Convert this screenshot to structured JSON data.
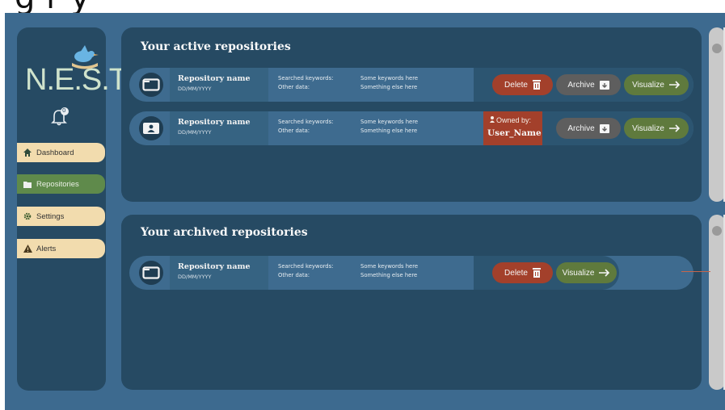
{
  "header": {
    "cut_heading": "g                    r                              y"
  },
  "sidebar": {
    "logo_text": "N.E.S.T.",
    "notification_count": "0",
    "items": [
      {
        "label": "Dashboard",
        "icon": "home-icon",
        "active": false
      },
      {
        "label": "Repositories",
        "icon": "folder-icon",
        "active": true
      },
      {
        "label": "Settings",
        "icon": "gear-icon",
        "active": false
      },
      {
        "label": "Alerts",
        "icon": "warning-icon",
        "active": false
      }
    ]
  },
  "active_panel": {
    "title": "Your active repositories",
    "rows": [
      {
        "name": "Repository name",
        "date": "DD/MM/YYYY",
        "meta_label_1": "Searched keywords:",
        "meta_value_1": "Some keywords here",
        "meta_label_2": "Other data:",
        "meta_value_2": "Something else here",
        "delete_label": "Delete",
        "archive_label": "Archive",
        "visualize_label": "Visualize",
        "owned": false
      },
      {
        "name": "Repository name",
        "date": "DD/MM/YYYY",
        "meta_label_1": "Searched keywords:",
        "meta_value_1": "Some keywords here",
        "meta_label_2": "Other data:",
        "meta_value_2": "Something else here",
        "owned_label": "Owned by:",
        "owned_user": "User_Name",
        "archive_label": "Archive",
        "visualize_label": "Visualize",
        "owned": true
      }
    ]
  },
  "archived_panel": {
    "title": "Your archived repositories",
    "rows": [
      {
        "name": "Repository name",
        "date": "DD/MM/YYYY",
        "meta_label_1": "Searched keywords:",
        "meta_value_1": "Some keywords here",
        "meta_label_2": "Other data:",
        "meta_value_2": "Something else here",
        "delete_label": "Delete",
        "visualize_label": "Visualize"
      }
    ]
  },
  "colors": {
    "background": "#3d6a8f",
    "panel": "#264a63",
    "delete": "#a3402b",
    "archive": "#5e5e5e",
    "visualize": "#5f7a3d",
    "nav_inactive": "#f2dcae",
    "nav_active": "#5f8a4b"
  }
}
